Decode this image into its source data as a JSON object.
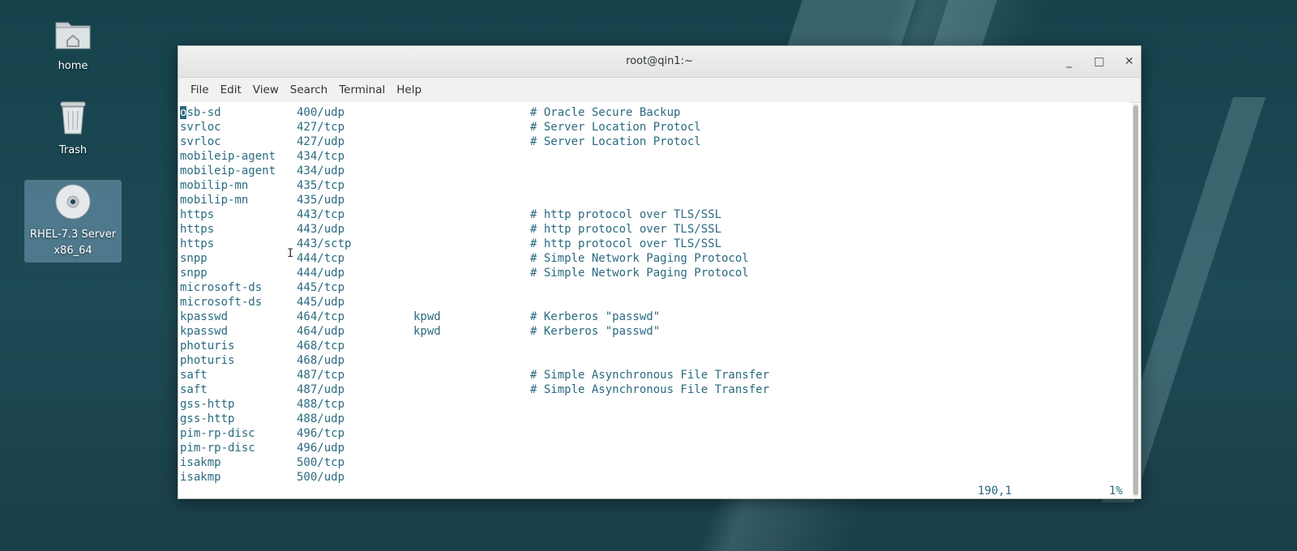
{
  "desktop": {
    "icons": [
      {
        "label": "home",
        "icon": "folder-home-icon"
      },
      {
        "label": "Trash",
        "icon": "trash-icon"
      },
      {
        "label": "RHEL-7.3 Server x86_64",
        "icon": "disc-icon"
      }
    ]
  },
  "window": {
    "title": "root@qin1:~",
    "controls": {
      "minimize": "_",
      "maximize": "□",
      "close": "✕"
    }
  },
  "menubar": [
    "File",
    "Edit",
    "View",
    "Search",
    "Terminal",
    "Help"
  ],
  "terminal": {
    "lines": [
      {
        "name": "osb-sd",
        "port": "400/udp",
        "alias": "",
        "comment": "# Oracle Secure Backup"
      },
      {
        "name": "svrloc",
        "port": "427/tcp",
        "alias": "",
        "comment": "# Server Location Protocl"
      },
      {
        "name": "svrloc",
        "port": "427/udp",
        "alias": "",
        "comment": "# Server Location Protocl"
      },
      {
        "name": "mobileip-agent",
        "port": "434/tcp",
        "alias": "",
        "comment": ""
      },
      {
        "name": "mobileip-agent",
        "port": "434/udp",
        "alias": "",
        "comment": ""
      },
      {
        "name": "mobilip-mn",
        "port": "435/tcp",
        "alias": "",
        "comment": ""
      },
      {
        "name": "mobilip-mn",
        "port": "435/udp",
        "alias": "",
        "comment": ""
      },
      {
        "name": "https",
        "port": "443/tcp",
        "alias": "",
        "comment": "# http protocol over TLS/SSL"
      },
      {
        "name": "https",
        "port": "443/udp",
        "alias": "",
        "comment": "# http protocol over TLS/SSL"
      },
      {
        "name": "https",
        "port": "443/sctp",
        "alias": "",
        "comment": "# http protocol over TLS/SSL"
      },
      {
        "name": "snpp",
        "port": "444/tcp",
        "alias": "",
        "comment": "# Simple Network Paging Protocol"
      },
      {
        "name": "snpp",
        "port": "444/udp",
        "alias": "",
        "comment": "# Simple Network Paging Protocol"
      },
      {
        "name": "microsoft-ds",
        "port": "445/tcp",
        "alias": "",
        "comment": ""
      },
      {
        "name": "microsoft-ds",
        "port": "445/udp",
        "alias": "",
        "comment": ""
      },
      {
        "name": "kpasswd",
        "port": "464/tcp",
        "alias": "kpwd",
        "comment": "# Kerberos \"passwd\""
      },
      {
        "name": "kpasswd",
        "port": "464/udp",
        "alias": "kpwd",
        "comment": "# Kerberos \"passwd\""
      },
      {
        "name": "photuris",
        "port": "468/tcp",
        "alias": "",
        "comment": ""
      },
      {
        "name": "photuris",
        "port": "468/udp",
        "alias": "",
        "comment": ""
      },
      {
        "name": "saft",
        "port": "487/tcp",
        "alias": "",
        "comment": "# Simple Asynchronous File Transfer"
      },
      {
        "name": "saft",
        "port": "487/udp",
        "alias": "",
        "comment": "# Simple Asynchronous File Transfer"
      },
      {
        "name": "gss-http",
        "port": "488/tcp",
        "alias": "",
        "comment": ""
      },
      {
        "name": "gss-http",
        "port": "488/udp",
        "alias": "",
        "comment": ""
      },
      {
        "name": "pim-rp-disc",
        "port": "496/tcp",
        "alias": "",
        "comment": ""
      },
      {
        "name": "pim-rp-disc",
        "port": "496/udp",
        "alias": "",
        "comment": ""
      },
      {
        "name": "isakmp",
        "port": "500/tcp",
        "alias": "",
        "comment": ""
      },
      {
        "name": "isakmp",
        "port": "500/udp",
        "alias": "",
        "comment": ""
      }
    ],
    "status": {
      "position": "190,1",
      "percent": "1%"
    }
  },
  "colors": {
    "terminal_text": "#2a6a80",
    "desktop_bg": "#1d4650"
  }
}
